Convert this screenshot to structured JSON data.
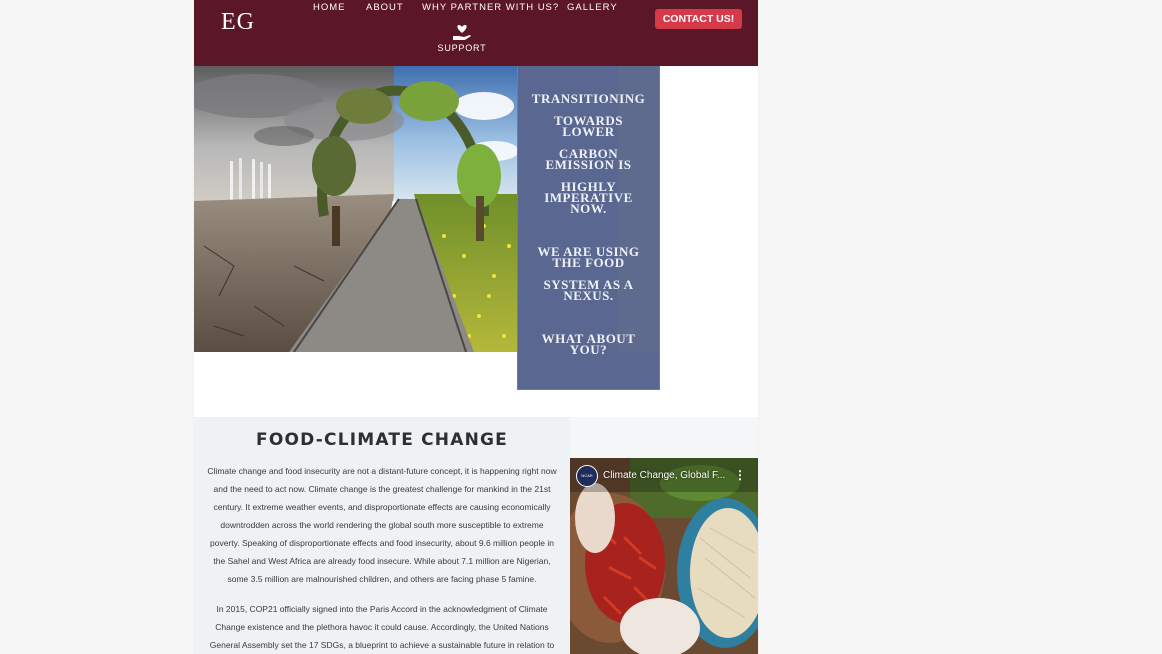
{
  "header": {
    "logo": "EG",
    "nav": [
      "HOME",
      "ABOUT",
      "WHY PARTNER WITH US?",
      "GALLERY"
    ],
    "support_label": "SUPPORT",
    "contact_label": "CONTACT US!"
  },
  "hero": {
    "lines": [
      "TRANSITIONING",
      "TOWARDS",
      "LOWER",
      "CARBON",
      "EMISSION IS",
      "HIGHLY",
      "IMPERATIVE",
      "NOW.",
      "WE ARE USING",
      "THE FOOD",
      "SYSTEM AS A",
      "NEXUS.",
      "WHAT ABOUT",
      "YOU?"
    ]
  },
  "section": {
    "title": "FOOD-CLIMATE CHANGE",
    "paragraph1_lines": [
      "Climate change and food insecurity are not a distant-future concept, it is happening right now",
      "and the need to act now. Climate change is the greatest challenge for mankind in the 21st",
      "century. It extreme weather events, and disproportionate effects are causing economically",
      "downtrodden across the world rendering the global south more susceptible to extreme",
      "poverty. Speaking of disproportionate effects and food insecurity, about 9.6 million people in",
      "the Sahel and West Africa are already food insecure. While about 7.1 million are Nigerian,",
      "some 3.5 million are malnourished children, and others are facing phase 5 famine."
    ],
    "paragraph2_lines": [
      "In 2015, COP21 officially signed into the Paris Accord in the acknowledgment of Climate",
      "Change existence and the plethora havoc it could cause. Accordingly, the United Nations",
      "General Assembly set the 17 SDGs, a blueprint to achieve a sustainable future in relation to"
    ]
  },
  "video": {
    "title": "Climate Change, Global F...",
    "menu_icon": "more-vert-icon"
  },
  "colors": {
    "header_bg": "#5b1627",
    "contact_btn": "#d53a4b",
    "overlay": "#5a6790",
    "section_bg": "#eef2f5"
  }
}
